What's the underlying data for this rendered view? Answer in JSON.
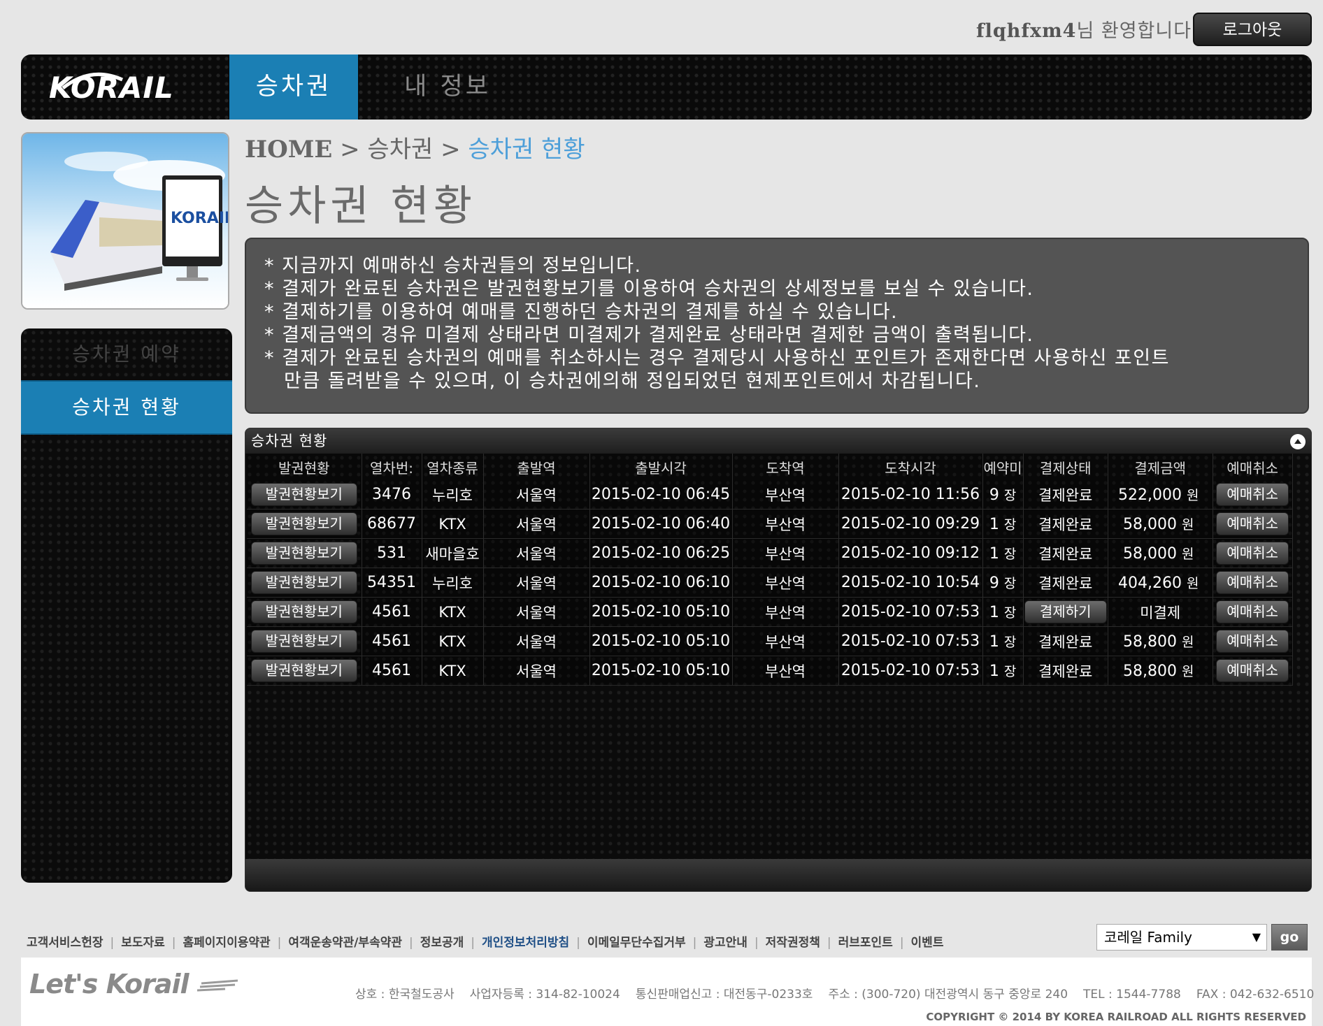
{
  "header": {
    "username": "flqhfxm4",
    "welcome_suffix": "님 환영합니다.",
    "logout_label": "로그아웃"
  },
  "nav": {
    "logo_text": "KORAIL",
    "tabs": [
      {
        "label": "승차권",
        "active": true
      },
      {
        "label": "내 정보",
        "active": false
      }
    ]
  },
  "sidebar": {
    "items": [
      {
        "label": "승차권 예약",
        "active": false
      },
      {
        "label": "승차권 현황",
        "active": true
      }
    ]
  },
  "breadcrumb": {
    "home": "HOME",
    "sep": ">",
    "section": "승차권",
    "current": "승차권 현황"
  },
  "page_title": "승차권 현황",
  "info": {
    "lines": [
      "* 지금까지 예매하신 승차권들의 정보입니다.",
      "* 결제가 완료된 승차권은 발권현황보기를 이용하여 승차권의 상세정보를 보실 수 있습니다.",
      "* 결제하기를 이용하여 예매를 진행하던 승차권의 결제를 하실 수 있습니다.",
      "* 결제금액의 경유 미결제 상태라면 미결제가 결제완료 상태라면 결제한 금액이 출력됩니다.",
      "* 결제가 완료된 승차권의 예매를 취소하시는 경우 결제당시 사용하신 포인트가 존재한다면 사용하신 포인트",
      "만큼 돌려받을 수 있으며, 이 승차권에의해 정입되었던 현제포인트에서 차감됩니다."
    ]
  },
  "grid": {
    "caption": "승차권 현황",
    "columns": [
      "발권현황",
      "열차번:",
      "열차종류",
      "출발역",
      "출발시각",
      "도착역",
      "도착시각",
      "예약미",
      "결제상태",
      "결제금액",
      "예매취소"
    ],
    "view_btn_label": "발권현황보기",
    "cancel_btn_label": "예매취소",
    "pay_btn_label": "결제하기",
    "seat_unit": "장",
    "won_unit": "원",
    "rows": [
      {
        "train_no": "3476",
        "train_type": "누리호",
        "dep_station": "서울역",
        "dep_time": "2015-02-10 06:45",
        "arr_station": "부산역",
        "arr_time": "2015-02-10 11:56",
        "seats": "9",
        "status": "결제완료",
        "amount": "522,000"
      },
      {
        "train_no": "68677",
        "train_type": "KTX",
        "dep_station": "서울역",
        "dep_time": "2015-02-10 06:40",
        "arr_station": "부산역",
        "arr_time": "2015-02-10 09:29",
        "seats": "1",
        "status": "결제완료",
        "amount": "58,000"
      },
      {
        "train_no": "531",
        "train_type": "새마을호",
        "dep_station": "서울역",
        "dep_time": "2015-02-10 06:25",
        "arr_station": "부산역",
        "arr_time": "2015-02-10 09:12",
        "seats": "1",
        "status": "결제완료",
        "amount": "58,000"
      },
      {
        "train_no": "54351",
        "train_type": "누리호",
        "dep_station": "서울역",
        "dep_time": "2015-02-10 06:10",
        "arr_station": "부산역",
        "arr_time": "2015-02-10 10:54",
        "seats": "9",
        "status": "결제완료",
        "amount": "404,260"
      },
      {
        "train_no": "4561",
        "train_type": "KTX",
        "dep_station": "서울역",
        "dep_time": "2015-02-10 05:10",
        "arr_station": "부산역",
        "arr_time": "2015-02-10 07:53",
        "seats": "1",
        "status": "결제하기",
        "amount": "미결제"
      },
      {
        "train_no": "4561",
        "train_type": "KTX",
        "dep_station": "서울역",
        "dep_time": "2015-02-10 05:10",
        "arr_station": "부산역",
        "arr_time": "2015-02-10 07:53",
        "seats": "1",
        "status": "결제완료",
        "amount": "58,800"
      },
      {
        "train_no": "4561",
        "train_type": "KTX",
        "dep_station": "서울역",
        "dep_time": "2015-02-10 05:10",
        "arr_station": "부산역",
        "arr_time": "2015-02-10 07:53",
        "seats": "1",
        "status": "결제완료",
        "amount": "58,800"
      }
    ]
  },
  "footer": {
    "links": [
      "고객서비스헌장",
      "보도자료",
      "홈페이지이용약관",
      "여객운송약관/부속약관",
      "정보공개",
      "개인정보처리방침",
      "이메일무단수집거부",
      "광고안내",
      "저작권정책",
      "러브포인트",
      "이벤트"
    ],
    "highlight_link": "개인정보처리방침",
    "family_select": "코레일 Family",
    "go_label": "go",
    "brand": "Let's Korail",
    "corp": [
      "상호 : 한국철도공사",
      "사업자등록 : 314-82-10024",
      "통신판매업신고 : 대전동구-0233호",
      "주소 : (300-720) 대전광역시 동구 중앙로 240",
      "TEL : 1544-7788",
      "FAX : 042-632-6510"
    ],
    "copyright": "COPYRIGHT © 2014 BY KOREA RAILROAD  ALL RIGHTS RESERVED"
  },
  "colors": {
    "accent_blue": "#1b7fb4",
    "breadcrumb_current": "#4d9fd9",
    "panel_dark": "#0b0b0b",
    "info_bg": "#545454"
  }
}
